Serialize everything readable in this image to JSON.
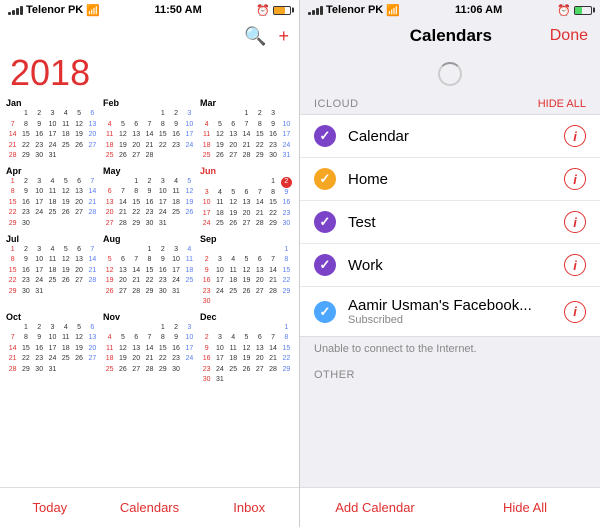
{
  "left": {
    "status": {
      "carrier": "Telenor PK",
      "time": "11:50 AM",
      "battery_pct": 67
    },
    "year": "2018",
    "toolbar": {
      "search_label": "🔍",
      "add_label": "+"
    },
    "months": [
      {
        "name": "Jan",
        "red": false,
        "days": [
          [
            "",
            "1",
            "2",
            "3",
            "4",
            "5",
            "6"
          ],
          [
            "7",
            "8",
            "9",
            "10",
            "11",
            "12",
            "13"
          ],
          [
            "14",
            "15",
            "16",
            "17",
            "18",
            "19",
            "20"
          ],
          [
            "21",
            "22",
            "23",
            "24",
            "25",
            "26",
            "27"
          ],
          [
            "28",
            "29",
            "30",
            "31",
            "",
            "",
            ""
          ]
        ]
      },
      {
        "name": "Feb",
        "red": false,
        "days": [
          [
            "",
            "",
            "",
            "",
            "1",
            "2",
            "3"
          ],
          [
            "4",
            "5",
            "6",
            "7",
            "8",
            "9",
            "10"
          ],
          [
            "11",
            "12",
            "13",
            "14",
            "15",
            "16",
            "17"
          ],
          [
            "18",
            "19",
            "20",
            "21",
            "22",
            "23",
            "24"
          ],
          [
            "25",
            "26",
            "27",
            "28",
            "",
            "",
            ""
          ]
        ]
      },
      {
        "name": "Mar",
        "red": false,
        "days": [
          [
            "",
            "",
            "",
            "1",
            "2",
            "3",
            ""
          ],
          [
            "4",
            "5",
            "6",
            "7",
            "8",
            "9",
            "10"
          ],
          [
            "11",
            "12",
            "13",
            "14",
            "15",
            "16",
            "17"
          ],
          [
            "18",
            "19",
            "20",
            "21",
            "22",
            "23",
            "24"
          ],
          [
            "25",
            "26",
            "27",
            "28",
            "29",
            "30",
            "31"
          ]
        ]
      },
      {
        "name": "Apr",
        "red": false,
        "days": [
          [
            "1",
            "2",
            "3",
            "4",
            "5",
            "6",
            "7"
          ],
          [
            "8",
            "9",
            "10",
            "11",
            "12",
            "13",
            "14"
          ],
          [
            "15",
            "16",
            "17",
            "18",
            "19",
            "20",
            "21"
          ],
          [
            "22",
            "23",
            "24",
            "25",
            "26",
            "27",
            "28"
          ],
          [
            "29",
            "30",
            "",
            "",
            "",
            "",
            ""
          ]
        ]
      },
      {
        "name": "May",
        "red": false,
        "days": [
          [
            "",
            "",
            "1",
            "2",
            "3",
            "4",
            "5"
          ],
          [
            "6",
            "7",
            "8",
            "9",
            "10",
            "11",
            "12"
          ],
          [
            "13",
            "14",
            "15",
            "16",
            "17",
            "18",
            "19"
          ],
          [
            "20",
            "21",
            "22",
            "23",
            "24",
            "25",
            "26"
          ],
          [
            "27",
            "28",
            "29",
            "30",
            "31",
            "",
            ""
          ]
        ]
      },
      {
        "name": "Jun",
        "red": true,
        "days": [
          [
            "",
            "",
            "",
            "",
            "",
            "1",
            "2"
          ],
          [
            "3",
            "4",
            "5",
            "6",
            "7",
            "8",
            "9"
          ],
          [
            "10",
            "11",
            "12",
            "13",
            "14",
            "15",
            "16"
          ],
          [
            "17",
            "18",
            "19",
            "20",
            "21",
            "22",
            "23"
          ],
          [
            "24",
            "25",
            "26",
            "27",
            "28",
            "29",
            "30"
          ]
        ],
        "circle_day": "2"
      },
      {
        "name": "Jul",
        "red": false,
        "days": [
          [
            "1",
            "2",
            "3",
            "4",
            "5",
            "6",
            "7"
          ],
          [
            "8",
            "9",
            "10",
            "11",
            "12",
            "13",
            "14"
          ],
          [
            "15",
            "16",
            "17",
            "18",
            "19",
            "20",
            "21"
          ],
          [
            "22",
            "23",
            "24",
            "25",
            "26",
            "27",
            "28"
          ],
          [
            "29",
            "30",
            "31",
            "",
            "",
            "",
            ""
          ]
        ]
      },
      {
        "name": "Aug",
        "red": false,
        "days": [
          [
            "",
            "",
            "",
            "1",
            "2",
            "3",
            "4"
          ],
          [
            "5",
            "6",
            "7",
            "8",
            "9",
            "10",
            "11"
          ],
          [
            "12",
            "13",
            "14",
            "15",
            "16",
            "17",
            "18"
          ],
          [
            "19",
            "20",
            "21",
            "22",
            "23",
            "24",
            "25"
          ],
          [
            "26",
            "27",
            "28",
            "29",
            "30",
            "31",
            ""
          ]
        ]
      },
      {
        "name": "Sep",
        "red": false,
        "days": [
          [
            "",
            "",
            "",
            "",
            "",
            "",
            "1"
          ],
          [
            "2",
            "3",
            "4",
            "5",
            "6",
            "7",
            "8"
          ],
          [
            "9",
            "10",
            "11",
            "12",
            "13",
            "14",
            "15"
          ],
          [
            "16",
            "17",
            "18",
            "19",
            "20",
            "21",
            "22"
          ],
          [
            "23",
            "24",
            "25",
            "26",
            "27",
            "28",
            "29"
          ],
          [
            "30",
            "",
            "",
            "",
            "",
            "",
            ""
          ]
        ]
      },
      {
        "name": "Oct",
        "red": false,
        "days": [
          [
            "",
            "1",
            "2",
            "3",
            "4",
            "5",
            "6"
          ],
          [
            "7",
            "8",
            "9",
            "10",
            "11",
            "12",
            "13"
          ],
          [
            "14",
            "15",
            "16",
            "17",
            "18",
            "19",
            "20"
          ],
          [
            "21",
            "22",
            "23",
            "24",
            "25",
            "26",
            "27"
          ],
          [
            "28",
            "29",
            "30",
            "31",
            "",
            "",
            ""
          ]
        ]
      },
      {
        "name": "Nov",
        "red": false,
        "days": [
          [
            "",
            "",
            "",
            "",
            "1",
            "2",
            "3"
          ],
          [
            "4",
            "5",
            "6",
            "7",
            "8",
            "9",
            "10"
          ],
          [
            "11",
            "12",
            "13",
            "14",
            "15",
            "16",
            "17"
          ],
          [
            "18",
            "19",
            "20",
            "21",
            "22",
            "23",
            "24"
          ],
          [
            "25",
            "26",
            "27",
            "28",
            "29",
            "30",
            ""
          ]
        ]
      },
      {
        "name": "Dec",
        "red": false,
        "days": [
          [
            "",
            "",
            "",
            "",
            "",
            "",
            "1"
          ],
          [
            "2",
            "3",
            "4",
            "5",
            "6",
            "7",
            "8"
          ],
          [
            "9",
            "10",
            "11",
            "12",
            "13",
            "14",
            "15"
          ],
          [
            "16",
            "17",
            "18",
            "19",
            "20",
            "21",
            "22"
          ],
          [
            "23",
            "24",
            "25",
            "26",
            "27",
            "28",
            "29"
          ],
          [
            "30",
            "31",
            "",
            "",
            "",
            "",
            ""
          ]
        ]
      }
    ],
    "bottom_tabs": [
      "Today",
      "Calendars",
      "Inbox"
    ]
  },
  "right": {
    "status": {
      "carrier": "Telenor PK",
      "time": "11:06 AM",
      "battery_pct": 45
    },
    "nav": {
      "title": "Calendars",
      "done": "Done"
    },
    "icloud_section": "ICLOUD",
    "hide_all": "HIDE ALL",
    "calendars": [
      {
        "name": "Calendar",
        "color": "#7b44c8",
        "checked": true,
        "subscribed": false
      },
      {
        "name": "Home",
        "color": "#f5a623",
        "checked": true,
        "subscribed": false
      },
      {
        "name": "Test",
        "color": "#7b44c8",
        "checked": true,
        "subscribed": false
      },
      {
        "name": "Work",
        "color": "#7b44c8",
        "checked": true,
        "subscribed": false
      },
      {
        "name": "Aamir Usman's Facebook...",
        "color": "#4da6ff",
        "checked": true,
        "subscribed": true,
        "sub_label": "Subscribed"
      }
    ],
    "error_msg": "Unable to connect to the Internet.",
    "other_section": "OTHER",
    "bottom_tabs": [
      "Add Calendar",
      "Hide All"
    ]
  },
  "icons": {
    "search": "🔍",
    "add": "+",
    "info": "i",
    "check": "✓"
  }
}
